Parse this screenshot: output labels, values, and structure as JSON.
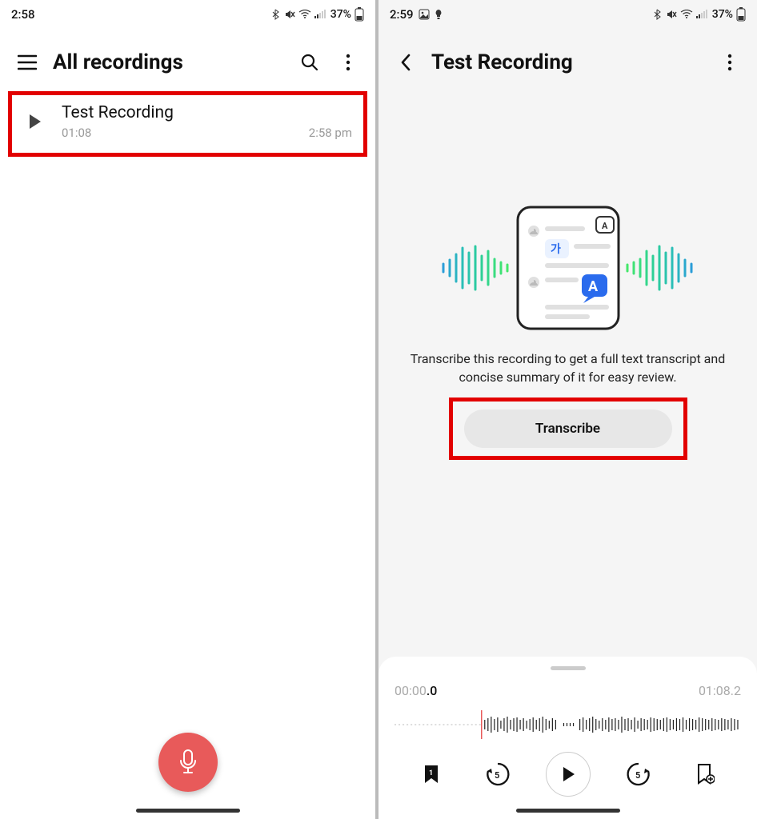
{
  "left": {
    "status": {
      "time": "2:58",
      "battery": "37%"
    },
    "header": {
      "title": "All recordings"
    },
    "recording": {
      "title": "Test Recording",
      "duration": "01:08",
      "timestamp": "2:58 pm"
    }
  },
  "right": {
    "status": {
      "time": "2:59",
      "battery": "37%"
    },
    "header": {
      "title": "Test Recording"
    },
    "description": "Transcribe this recording to get a full text transcript and concise summary of it for easy review.",
    "transcribe_label": "Transcribe",
    "player": {
      "current_prefix": "00:00",
      "current_suffix": ".0",
      "total": "01:08.2",
      "bookmark_count": "1"
    }
  }
}
